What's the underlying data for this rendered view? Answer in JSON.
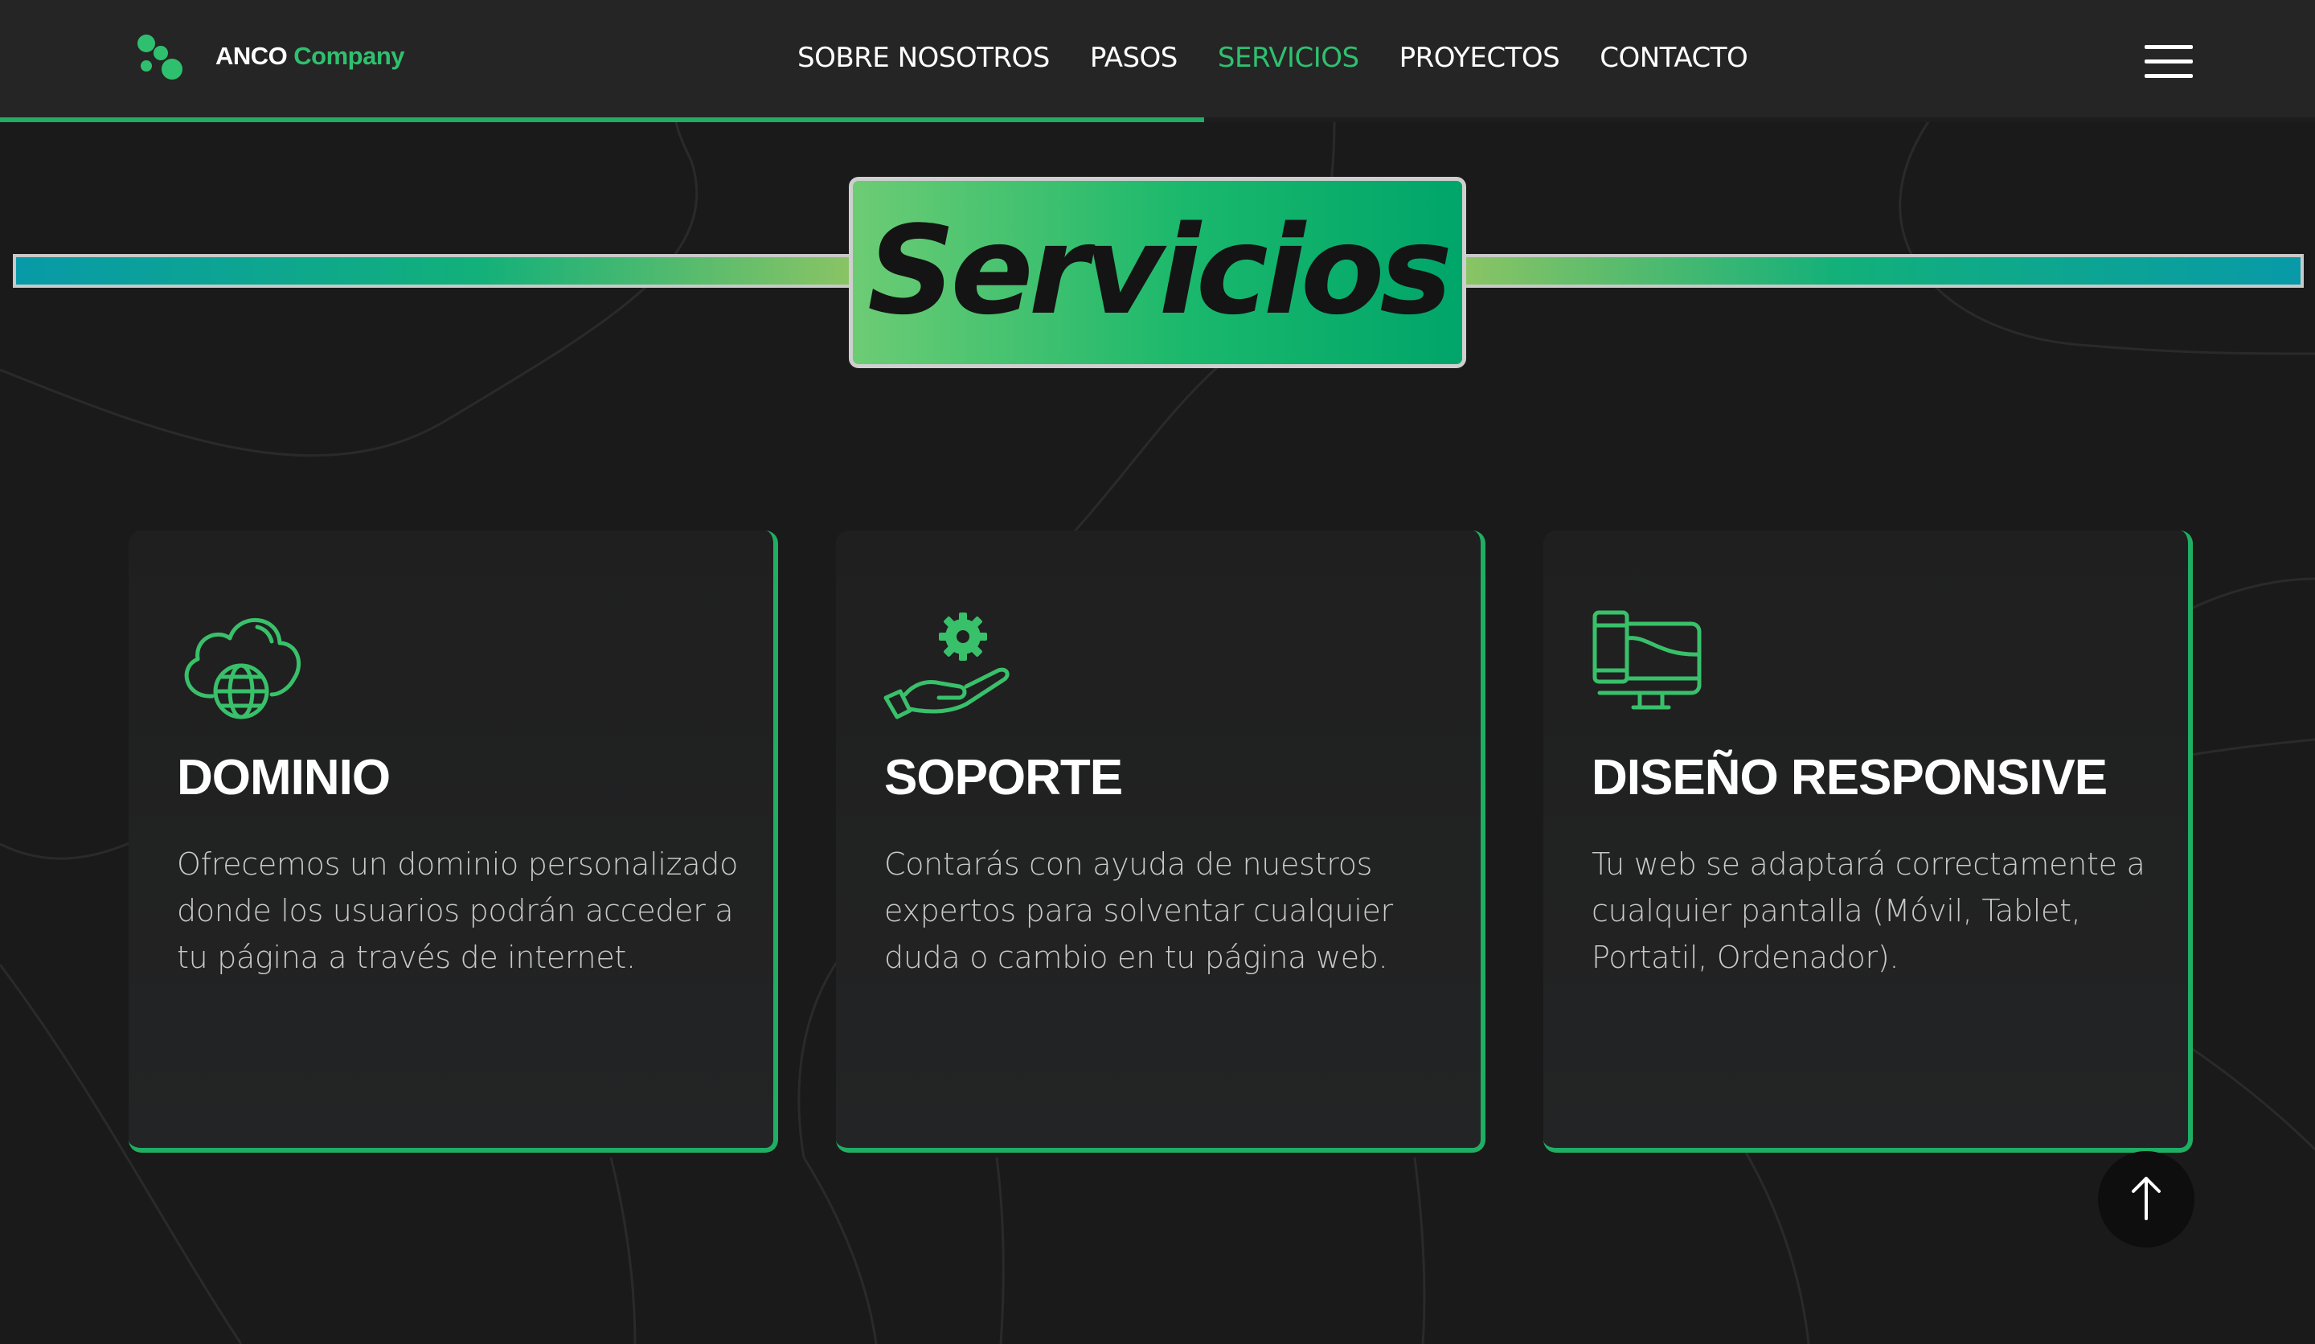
{
  "header": {
    "brand_main": "ANCO",
    "brand_accent": "Company",
    "scroll_progress_percent": 52
  },
  "nav": {
    "items": [
      {
        "label": "SOBRE NOSOTROS",
        "active": false
      },
      {
        "label": "PASOS",
        "active": false
      },
      {
        "label": "SERVICIOS",
        "active": true
      },
      {
        "label": "PROYECTOS",
        "active": false
      },
      {
        "label": "CONTACTO",
        "active": false
      }
    ],
    "menu_icon": "hamburger-menu-icon"
  },
  "section": {
    "title": "Servicios"
  },
  "cards": [
    {
      "icon": "cloud-globe-icon",
      "title": "DOMINIO",
      "text": "Ofrecemos un dominio personalizado donde los usuarios podrán acceder a tu página a través de internet."
    },
    {
      "icon": "hand-gear-icon",
      "title": "SOPORTE",
      "text": "Contarás con ayuda de nuestros expertos para solventar cualquier duda o cambio en tu página web."
    },
    {
      "icon": "responsive-devices-icon",
      "title": "DISEÑO RESPONSIVE",
      "text": "Tu web se adaptará correctamente a cualquier pantalla (Móvil, Tablet, Portatil, Ordenador)."
    }
  ],
  "scroll_top_icon": "arrow-up-icon",
  "colors": {
    "accent": "#1fae63",
    "background": "#1a1a1a",
    "navbar": "#252525"
  }
}
